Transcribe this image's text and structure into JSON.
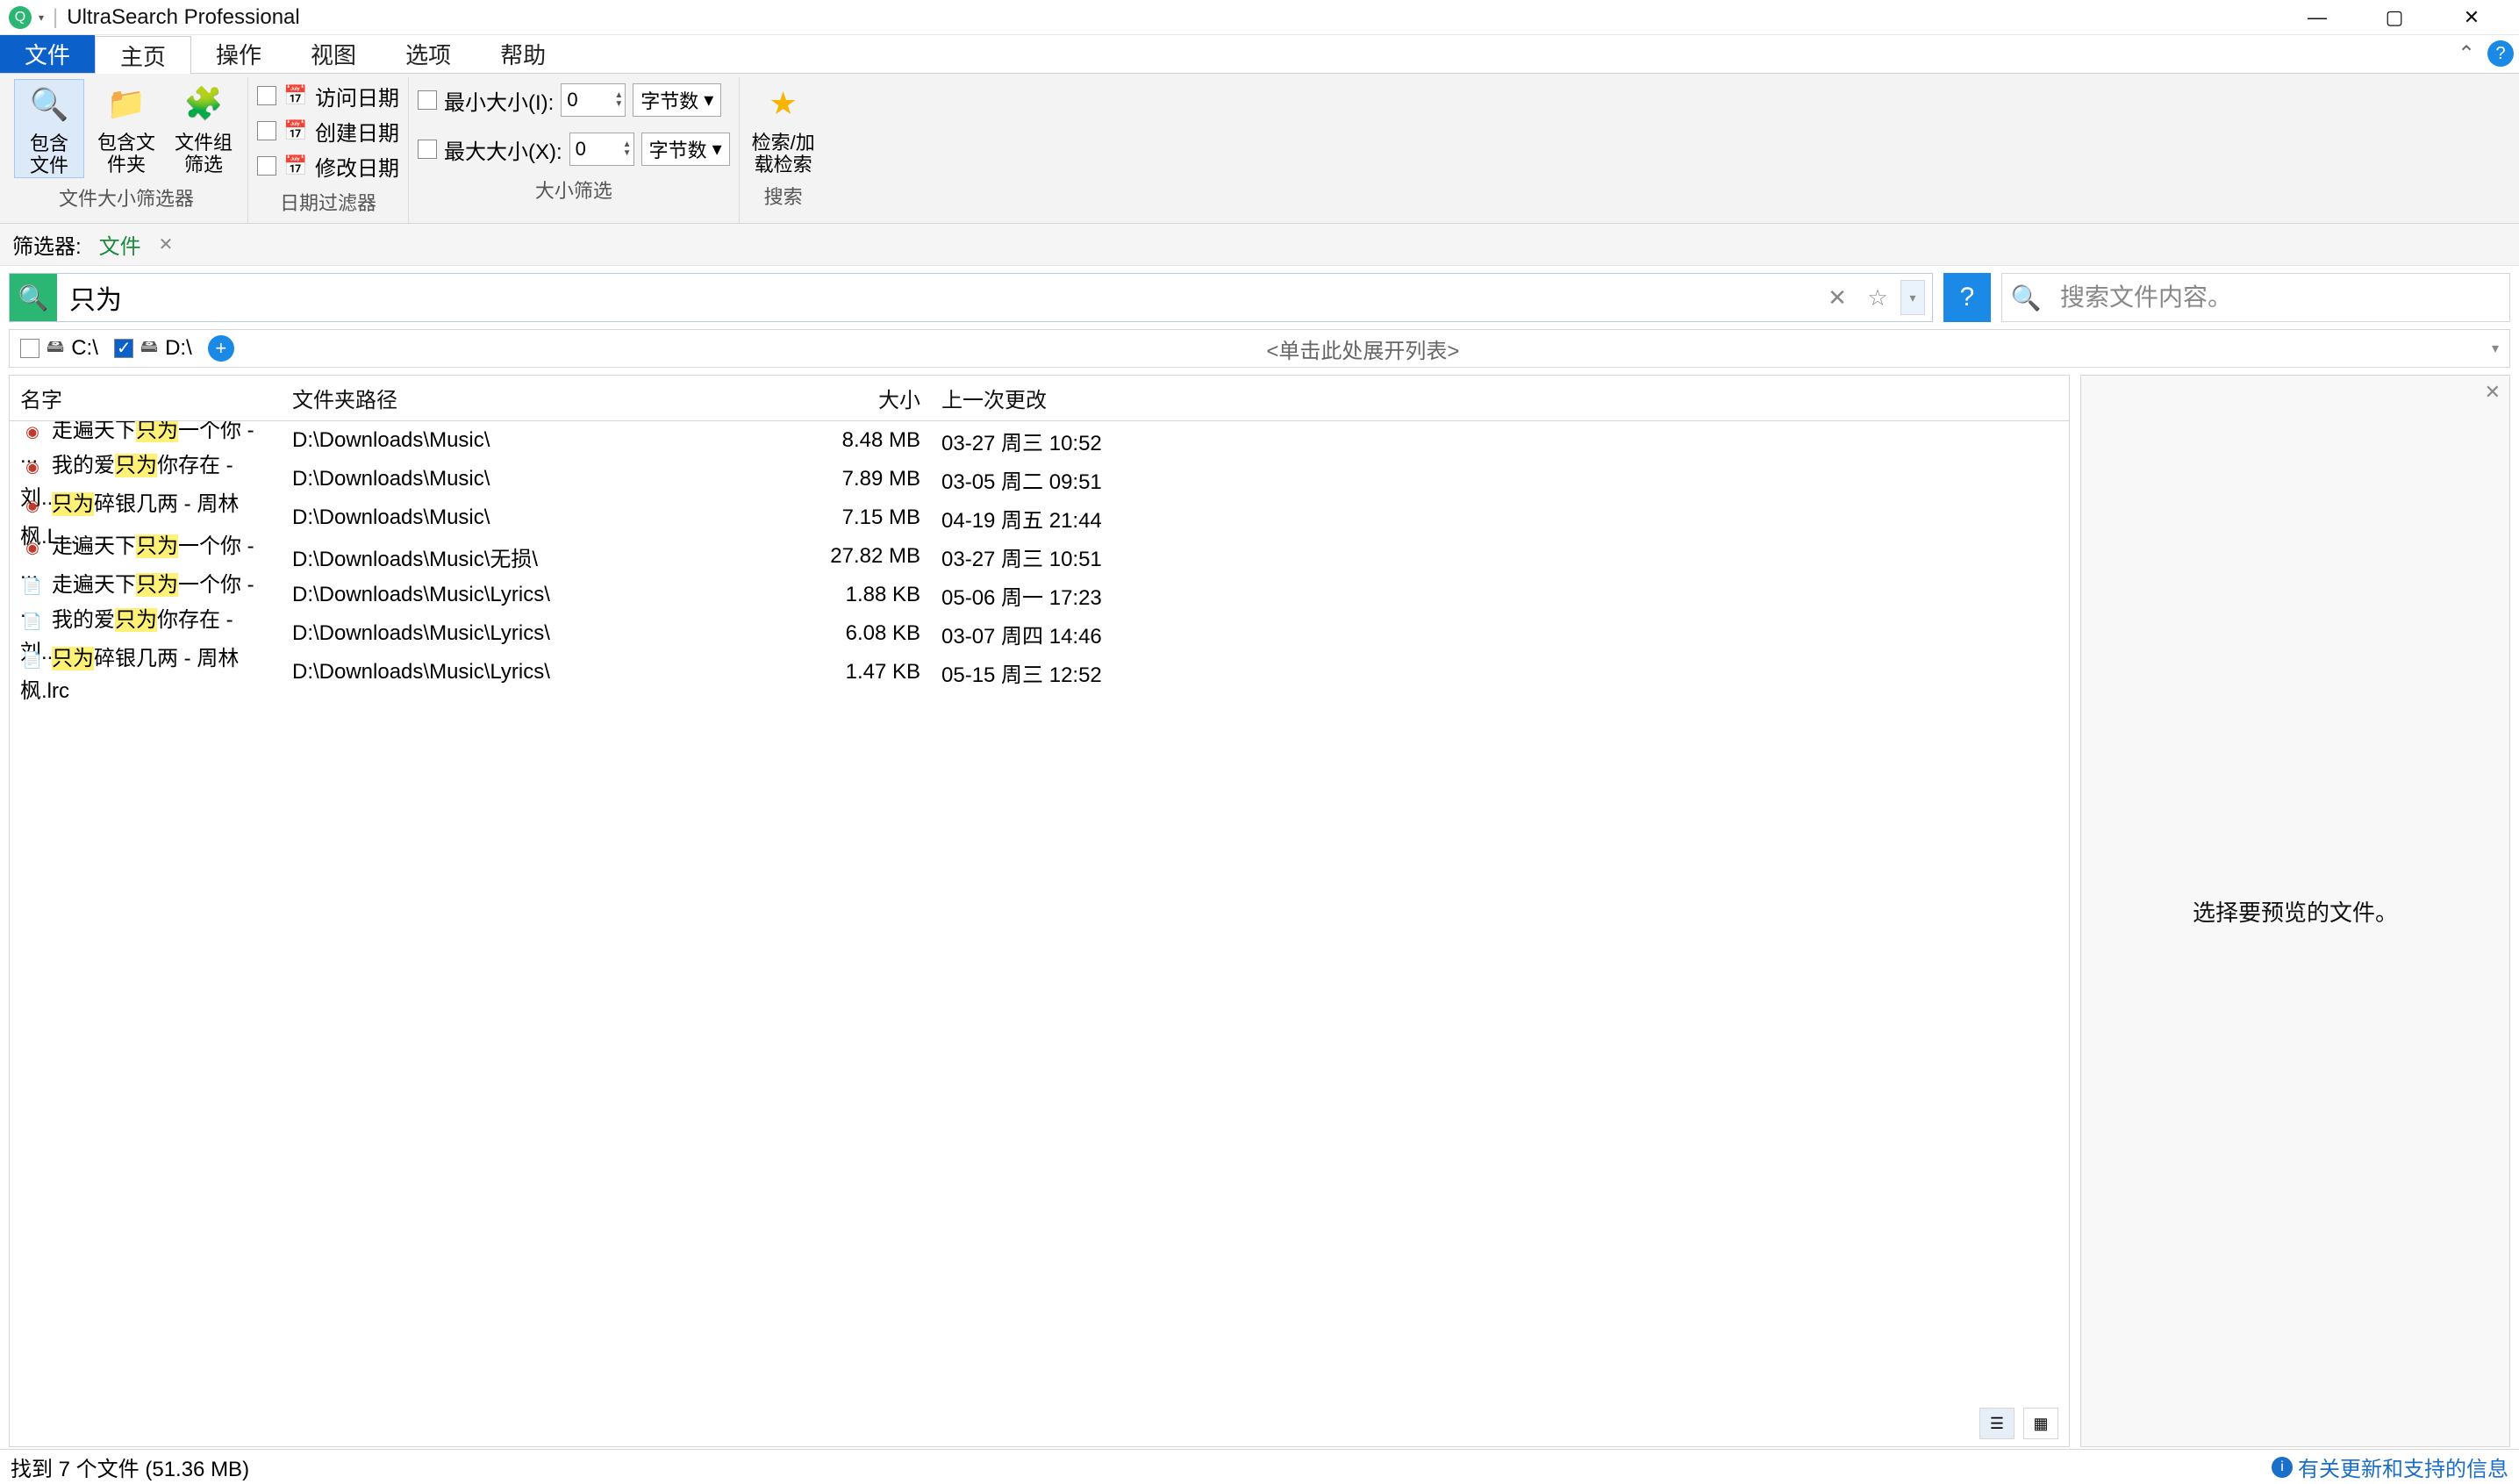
{
  "titlebar": {
    "app_title": "UltraSearch Professional"
  },
  "ribbon_tabs": {
    "file": "文件",
    "home": "主页",
    "operate": "操作",
    "view": "视图",
    "options": "选项",
    "help": "帮助"
  },
  "ribbon": {
    "size_filter": {
      "include_files": "包含\n文件",
      "include_folders": "包含文\n件夹",
      "filegroup_filter": "文件组\n筛选",
      "group_label": "文件大小筛选器"
    },
    "date_filter": {
      "access": "访问日期",
      "create": "创建日期",
      "modify": "修改日期",
      "group_label": "日期过滤器"
    },
    "size_range": {
      "min_label": "最小大小(I):",
      "max_label": "最大大小(X):",
      "min_value": "0",
      "max_value": "0",
      "unit": "字节数",
      "group_label": "大小筛选"
    },
    "search_group": {
      "label": "检索/加\n载检索",
      "group_label": "搜索"
    }
  },
  "filter_strip": {
    "label": "筛选器:",
    "active": "文件"
  },
  "search": {
    "value": "只为",
    "content_placeholder": "搜索文件内容。"
  },
  "drives": {
    "c": {
      "label": "C:\\",
      "checked": false
    },
    "d": {
      "label": "D:\\",
      "checked": true
    },
    "expand_hint": "<单击此处展开列表>"
  },
  "columns": {
    "name": "名字",
    "path": "文件夹路径",
    "size": "大小",
    "date": "上一次更改"
  },
  "results": [
    {
      "icon": "audio",
      "pre": "走遍天下",
      "hl": "只为",
      "post": "一个你 - ...",
      "path": "D:\\Downloads\\Music\\",
      "size": "8.48 MB",
      "date": "03-27 周三 10:52"
    },
    {
      "icon": "audio",
      "pre": "我的爱",
      "hl": "只为",
      "post": "你存在 - 刘...",
      "path": "D:\\Downloads\\Music\\",
      "size": "7.89 MB",
      "date": "03-05 周二 09:51"
    },
    {
      "icon": "audio",
      "pre": "",
      "hl": "只为",
      "post": "碎银几两 - 周林枫.L...",
      "path": "D:\\Downloads\\Music\\",
      "size": "7.15 MB",
      "date": "04-19 周五 21:44"
    },
    {
      "icon": "audio",
      "pre": "走遍天下",
      "hl": "只为",
      "post": "一个你 - ...",
      "path": "D:\\Downloads\\Music\\无损\\",
      "size": "27.82 MB",
      "date": "03-27 周三 10:51"
    },
    {
      "icon": "file",
      "pre": "走遍天下",
      "hl": "只为",
      "post": "一个你 - ...",
      "path": "D:\\Downloads\\Music\\Lyrics\\",
      "size": "1.88 KB",
      "date": "05-06 周一 17:23"
    },
    {
      "icon": "file",
      "pre": "我的爱",
      "hl": "只为",
      "post": "你存在 - 刘...",
      "path": "D:\\Downloads\\Music\\Lyrics\\",
      "size": "6.08 KB",
      "date": "03-07 周四 14:46"
    },
    {
      "icon": "file",
      "pre": "",
      "hl": "只为",
      "post": "碎银几两 - 周林枫.lrc",
      "path": "D:\\Downloads\\Music\\Lyrics\\",
      "size": "1.47 KB",
      "date": "05-15 周三 12:52"
    }
  ],
  "preview": {
    "msg": "选择要预览的文件。"
  },
  "status": {
    "found": "找到 7 个文件 (51.36 MB)",
    "update_link": "有关更新和支持的信息"
  }
}
